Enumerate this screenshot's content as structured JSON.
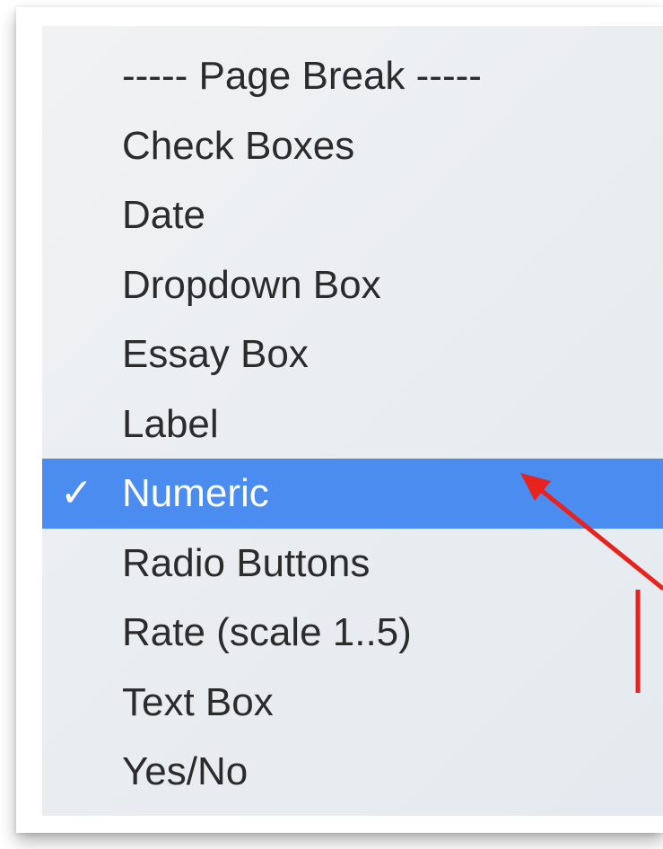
{
  "menu": {
    "items": [
      {
        "label": "----- Page Break -----"
      },
      {
        "label": "Check Boxes"
      },
      {
        "label": "Date"
      },
      {
        "label": "Dropdown Box"
      },
      {
        "label": "Essay Box"
      },
      {
        "label": "Label"
      },
      {
        "label": "Numeric",
        "selected": true,
        "check": "✓"
      },
      {
        "label": "Radio Buttons"
      },
      {
        "label": "Rate (scale 1..5)"
      },
      {
        "label": "Text Box"
      },
      {
        "label": "Yes/No"
      }
    ]
  },
  "colors": {
    "selection": "#4a8cf0",
    "annotation": "#e8231d",
    "text": "#2b2b2b"
  },
  "icons": {
    "checkmark": "checkmark-icon",
    "annotation_arrow": "annotation-arrow-icon"
  }
}
